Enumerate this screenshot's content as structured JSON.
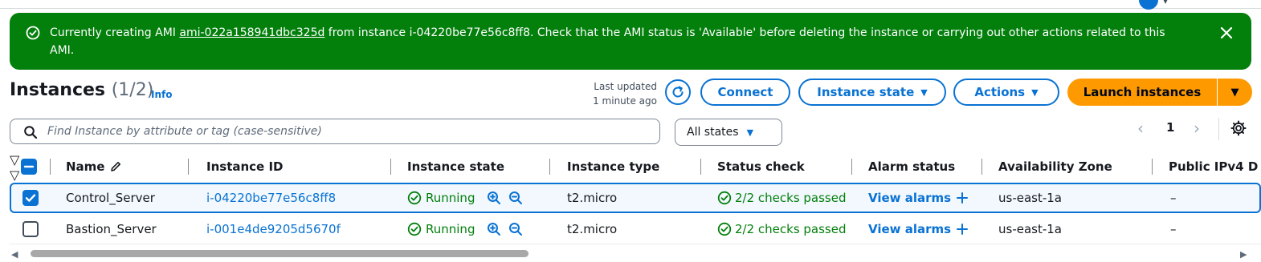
{
  "banner": {
    "prefix": "Currently creating AMI ",
    "ami_id": "ami-022a158941dbc325d",
    "suffix": " from instance i-04220be77e56c8ff8. Check that the AMI status is 'Available' before deleting the instance or carrying out other actions related to this AMI.",
    "color": "#037f0c"
  },
  "header": {
    "title": "Instances",
    "count": "(1/2)",
    "info": "Info",
    "last_updated_line1": "Last updated",
    "last_updated_line2": "1 minute ago",
    "connect": "Connect",
    "instance_state": "Instance state",
    "actions": "Actions",
    "launch": "Launch instances"
  },
  "filter": {
    "placeholder": "Find Instance by attribute or tag (case-sensitive)",
    "states": "All states",
    "page": "1"
  },
  "columns": [
    "Name",
    "Instance ID",
    "Instance state",
    "Instance type",
    "Status check",
    "Alarm status",
    "Availability Zone",
    "Public IPv4 D"
  ],
  "rows": [
    {
      "selected": true,
      "name": "Control_Server",
      "instance_id": "i-04220be77e56c8ff8",
      "state": "Running",
      "type": "t2.micro",
      "status_check": "2/2 checks passed",
      "alarm": "View alarms",
      "az": "us-east-1a",
      "public_ip": "–"
    },
    {
      "selected": false,
      "name": "Bastion_Server",
      "instance_id": "i-001e4de9205d5670f",
      "state": "Running",
      "type": "t2.micro",
      "status_check": "2/2 checks passed",
      "alarm": "View alarms",
      "az": "us-east-1a",
      "public_ip": "–"
    }
  ],
  "colors": {
    "link": "#0972d3",
    "accent": "#ff9900",
    "success": "#037f0c"
  }
}
